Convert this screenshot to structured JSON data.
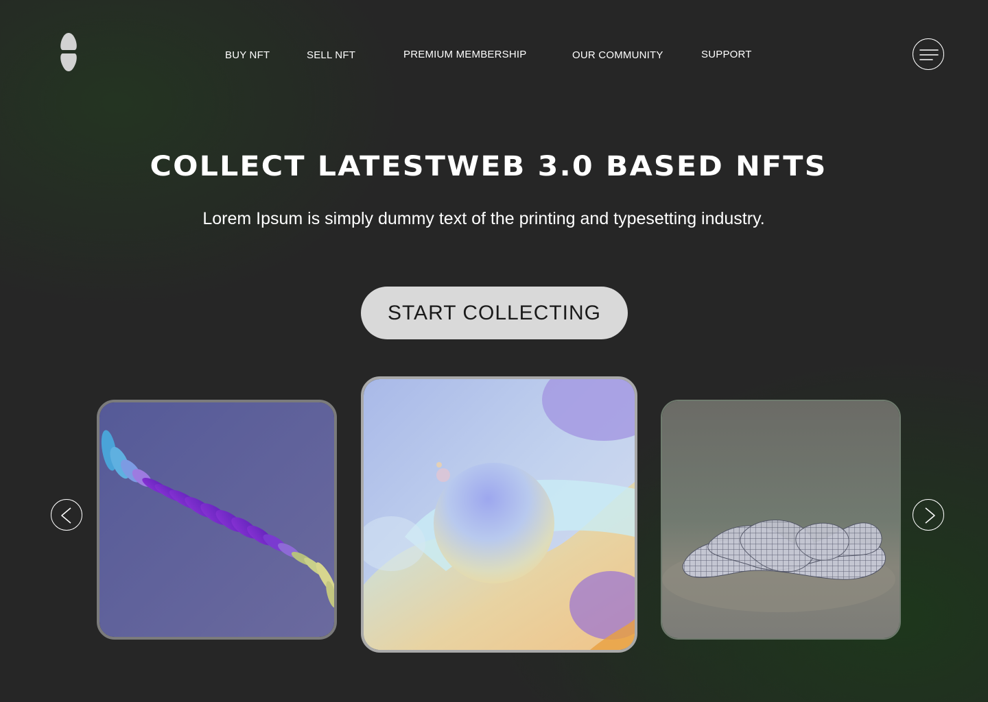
{
  "nav": {
    "links": [
      "BUY NFT",
      "SELL NFT",
      "PREMIUM MEMBERSHIP",
      "OUR COMMUNITY",
      "SUPPORT"
    ],
    "menu_icon": "hamburger-menu-icon",
    "logo_icon": "logo-icon"
  },
  "hero": {
    "title": "COLLECT LATESTWEB 3.0 BASED NFTS",
    "subtitle": "Lorem Ipsum is simply dummy text of the printing and typesetting industry.",
    "cta_label": "START COLLECTING"
  },
  "carousel": {
    "prev_icon": "chevron-left-icon",
    "next_icon": "chevron-right-icon",
    "cards": [
      {
        "image": "purple-ellipse-spiral-artwork"
      },
      {
        "image": "pastel-sphere-artwork"
      },
      {
        "image": "wireframe-knot-artwork"
      }
    ]
  },
  "colors": {
    "background": "#262626",
    "background_glow": "#1f3a1c",
    "text": "#ffffff",
    "button_bg": "#d9d9d9",
    "button_text": "#1a1a1a"
  }
}
